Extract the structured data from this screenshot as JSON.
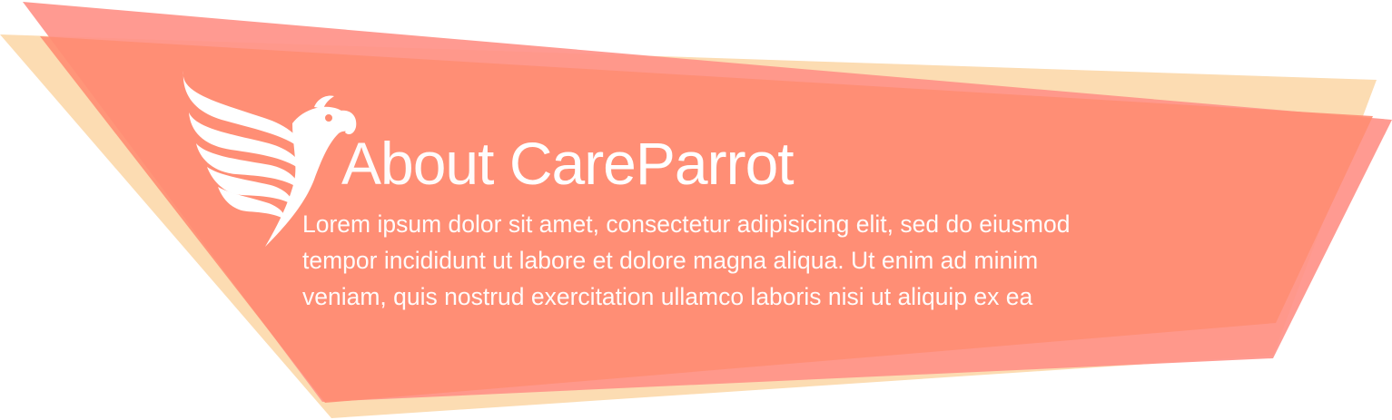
{
  "banner": {
    "heading_prefix": "About",
    "heading_brand": "CareParrot",
    "body_lines": [
      "Lorem ipsum dolor sit amet, consectetur adipisicing elit, sed do eiusmod",
      "tempor incididunt ut labore et dolore magna aliqua. Ut enim ad minim",
      "veniam, quis nostrud exercitation ullamco laboris nisi ut aliquip ex ea"
    ],
    "logo_icon": "parrot-logo-icon",
    "colors": {
      "back_shape": "#fcdcb2",
      "middle_shape": "#ff9188",
      "front_shape": "#ff8d72",
      "text": "#ffffff"
    }
  }
}
